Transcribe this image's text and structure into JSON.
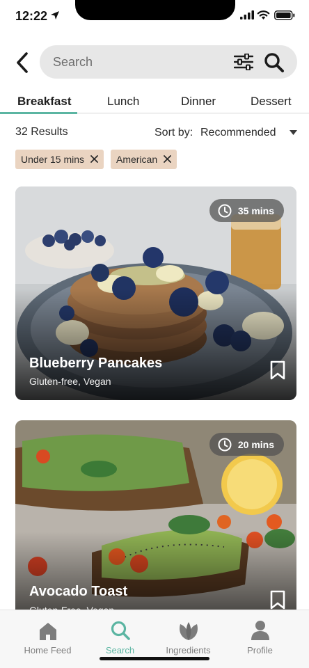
{
  "status_bar": {
    "time": "12:22"
  },
  "header": {
    "search_placeholder": "Search"
  },
  "tabs": [
    {
      "label": "Breakfast",
      "active": true
    },
    {
      "label": "Lunch",
      "active": false
    },
    {
      "label": "Dinner",
      "active": false
    },
    {
      "label": "Dessert",
      "active": false
    }
  ],
  "results": {
    "count_text": "32 Results",
    "sort_label": "Sort by:",
    "sort_value": "Recommended"
  },
  "filters": [
    {
      "label": "Under 15 mins"
    },
    {
      "label": "American"
    }
  ],
  "recipes": [
    {
      "title": "Blueberry Pancakes",
      "tags": "Gluten-free, Vegan",
      "time": "35 mins"
    },
    {
      "title": "Avocado Toast",
      "tags": "Gluten-Free, Vegan",
      "time": "20 mins"
    }
  ],
  "bottom_nav": [
    {
      "label": "Home Feed",
      "icon": "home-icon",
      "active": false
    },
    {
      "label": "Search",
      "icon": "search-icon",
      "active": true
    },
    {
      "label": "Ingredients",
      "icon": "leaf-icon",
      "active": false
    },
    {
      "label": "Profile",
      "icon": "person-icon",
      "active": false
    }
  ],
  "colors": {
    "accent": "#5bb5a2",
    "chip_bg": "#ead4c1",
    "search_bg": "#e7e7e7"
  }
}
